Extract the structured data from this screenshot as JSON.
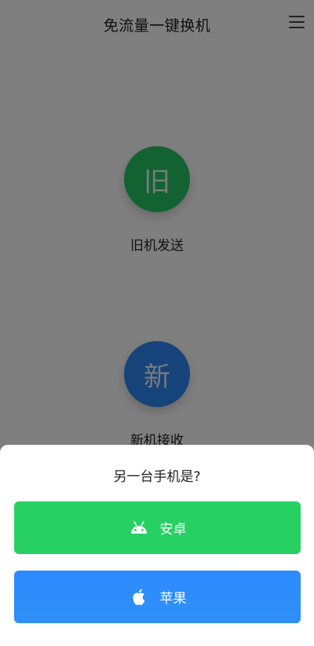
{
  "header": {
    "title": "免流量一键换机",
    "menu_icon": "hamburger-menu-icon"
  },
  "actions": {
    "old_phone": {
      "glyph": "旧",
      "label": "旧机发送",
      "color": "#26c564"
    },
    "new_phone": {
      "glyph": "新",
      "label": "新机接收",
      "color": "#2f86f6"
    }
  },
  "sheet": {
    "title": "另一台手机是?",
    "options": [
      {
        "label": "安卓",
        "icon": "android-icon",
        "color": "#27d063"
      },
      {
        "label": "苹果",
        "icon": "apple-icon",
        "color": "#2d8bff"
      }
    ]
  }
}
